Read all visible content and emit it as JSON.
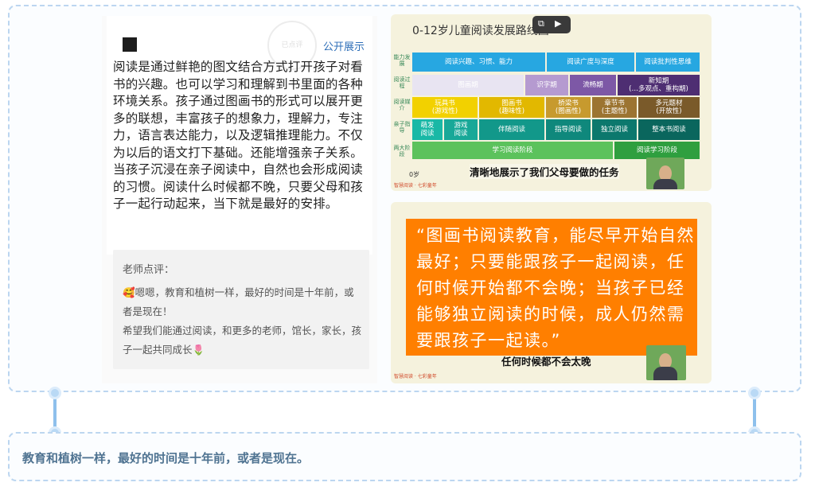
{
  "post": {
    "public_link": "公开展示",
    "stamp_text": "已点评",
    "body": "阅读是通过鲜艳的图文结合方式打开孩子对看书的兴趣。也可以学习和理解到书里面的各种环境关系。孩子通过图画书的形式可以展开更多的联想，丰富孩子的想象力，理解力，专注力，语言表达能力，以及逻辑推理能力。不仅为以后的语文打下基础。还能增强亲子关系。当孩子沉浸在亲子阅读中，自然也会形成阅读的习惯。阅读什么时候都不晚，只要父母和孩子一起行动起来，当下就是最好的安排。",
    "comment_title": "老师点评：",
    "comment_line1": "🥰嗯嗯，教育和植树一样，最好的时间是十年前，或者是现在！",
    "comment_line2": "希望我们能通过阅读，和更多的老师，馆长，家长，孩子一起共同成长🌷"
  },
  "slide1": {
    "title": "0-12岁儿童阅读发展路线图",
    "row_labels": [
      "能力发展",
      "阅读过程",
      "阅读媒介",
      "亲子指导",
      "两大阶段"
    ],
    "ability": [
      "阅读兴趣、习惯、能力",
      "阅读广度与深度",
      "阅读批判性思维"
    ],
    "process": [
      "图画期",
      "识字期",
      "流畅期",
      "新知期",
      "(…多观点、重构期)"
    ],
    "media": [
      [
        "玩具书",
        "(游戏性)"
      ],
      [
        "图画书",
        "(趣味性)"
      ],
      [
        "桥梁书",
        "(图画性)"
      ],
      [
        "章节书",
        "(主题性)"
      ],
      [
        "多元题材",
        "(开放性)"
      ]
    ],
    "guide": [
      [
        "萌发",
        "阅读"
      ],
      [
        "游戏",
        "阅读"
      ],
      [
        "伴随阅读"
      ],
      [
        "指导阅读"
      ],
      [
        "独立阅读"
      ],
      [
        "整本书阅读"
      ]
    ],
    "stages": [
      "学习阅读阶段",
      "阅读学习阶段"
    ],
    "zero_label": "0岁",
    "subtitle": "清晰地展示了我们父母要做的任务",
    "brand": "智慧阅读 · 七彩童年"
  },
  "slide2": {
    "quote": "“图画书阅读教育，能尽早开始自然最好；只要能跟孩子一起阅读，任何时候开始都不会晚；当孩子已经能够独立阅读的时候，成人仍然需要跟孩子一起读。”",
    "subtitle": "任何时候都不会太晚",
    "brand": "智慧阅读 · 七彩童年"
  },
  "caption": "教育和植树一样，最好的时间是十年前，或者是现在。",
  "colors": {
    "frame_border": "#bcd6f0",
    "caption": "#4f7391",
    "quote_bg": "#ff7f00",
    "link": "#2f6fb8"
  }
}
